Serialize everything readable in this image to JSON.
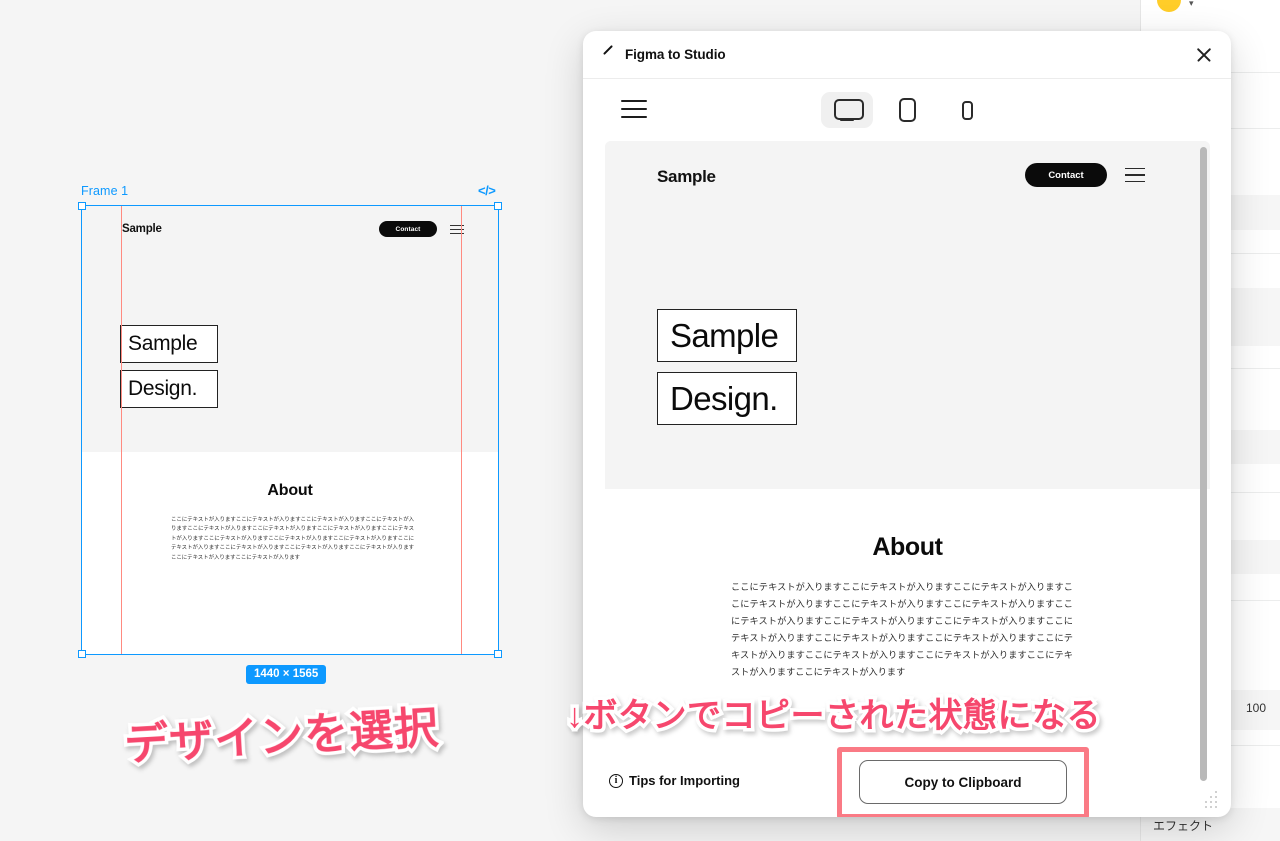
{
  "canvas": {
    "frame_label": "Frame 1",
    "dev_mode_icon": "</>",
    "dimensions_badge": "1440 × 1565",
    "mini_site": {
      "logo": "Sample",
      "contact_label": "Contact",
      "headline_1": "Sample",
      "headline_2": "Design.",
      "about_title": "About",
      "about_body": "ここにテキストが入りますここにテキストが入りますここにテキストが入りますここにテキストが入りますここにテキストが入りますここにテキストが入りますここにテキストが入りますここにテキストが入りますここにテキストが入りますここにテキストが入りますここにテキストが入りますここにテキストが入りますここにテキストが入りますここにテキストが入りますここにテキストが入りますここにテキストが入りますここにテキストが入ります"
    }
  },
  "annotations": {
    "left": "デザインを選択",
    "right": "↓ボタンでコピーされた状態になる",
    "color": "#f6476d"
  },
  "dialog": {
    "title": "Figma to Studio",
    "plugin_icon": "pen-slash-icon",
    "close_icon": "close-icon",
    "toolbar": {
      "menu_icon": "hamburger-menu-icon",
      "devices": [
        {
          "name": "desktop",
          "label": "Desktop",
          "selected": true
        },
        {
          "name": "tablet",
          "label": "Tablet",
          "selected": false
        },
        {
          "name": "mobile",
          "label": "Mobile",
          "selected": false
        }
      ]
    },
    "preview": {
      "logo": "Sample",
      "contact_label": "Contact",
      "menu_icon": "hamburger-menu-icon",
      "headline_1": "Sample",
      "headline_2": "Design.",
      "about_title": "About",
      "about_body": "ここにテキストが入りますここにテキストが入りますここにテキストが入りますここにテキストが入りますここにテキストが入りますここにテキストが入りますここにテキストが入りますここにテキストが入りますここにテキストが入りますここにテキストが入りますここにテキストが入りますここにテキストが入りますここにテキストが入りますここにテキストが入りますここにテキストが入りますここにテキストが入りますここにテキストが入ります"
    },
    "footer": {
      "tips_label": "Tips for Importing",
      "info_icon": "info-icon",
      "copy_label": "Copy to Clipboard",
      "highlight_color": "#fa7a85"
    }
  },
  "right_panel": {
    "dev_icon": "</>",
    "align_icon": "align-horizontal-icon",
    "distribute_icon": "distribute-icon",
    "opacity_value": "100",
    "effects_label": "エフェクト"
  },
  "colors": {
    "figma_blue": "#0d99ff",
    "canvas_bg": "#f5f5f5",
    "guide": "#ff8a80"
  }
}
